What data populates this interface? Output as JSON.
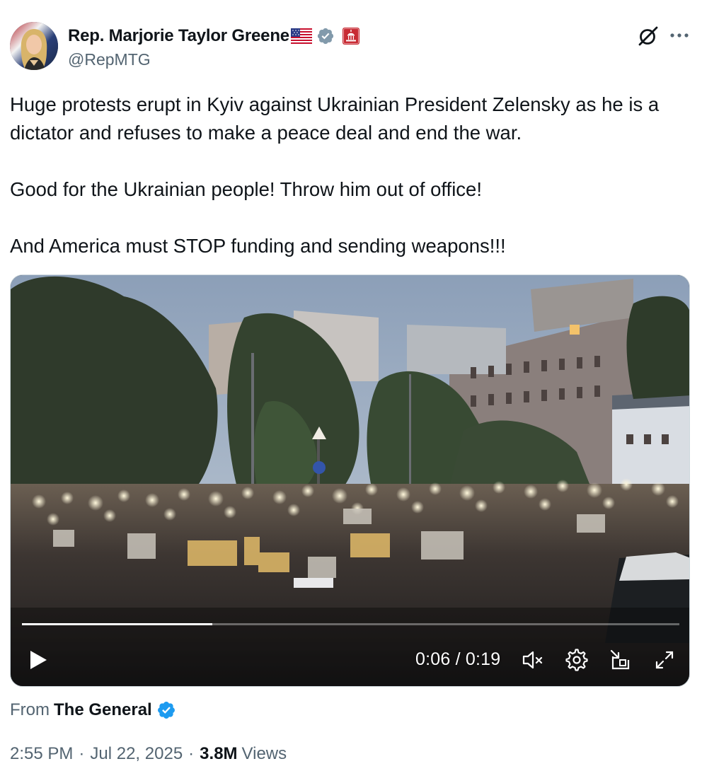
{
  "author": {
    "display_name": "Rep. Marjorie Taylor Greene",
    "handle": "@RepMTG",
    "badges": [
      "us-flag-icon",
      "verified-gray-icon",
      "government-building-icon"
    ]
  },
  "header_actions": {
    "grok": "grok-icon",
    "more": "more-dots-icon"
  },
  "tweet": {
    "text": "Huge protests erupt in Kyiv against Ukrainian President Zelensky as he is a dictator and refuses to make a peace deal and end the war.\n\nGood for the Ukrainian people! Throw him out of office!\n\nAnd America must STOP funding and sending weapons!!!"
  },
  "video": {
    "time_display": "0:06 / 0:19",
    "progress": 0.29,
    "controls": [
      "play-icon",
      "mute-icon",
      "settings-gear-icon",
      "pip-icon",
      "fullscreen-icon"
    ]
  },
  "source": {
    "prefix": "From",
    "name": "The General"
  },
  "meta": {
    "time": "2:55 PM",
    "date": "Jul 22, 2025",
    "views": "3.8M",
    "views_label": "Views"
  },
  "colors": {
    "text": "#0f1419",
    "secondary": "#536471",
    "verified_blue": "#1d9bf0",
    "verified_gray": "#829aab",
    "border": "#cfd9de"
  }
}
